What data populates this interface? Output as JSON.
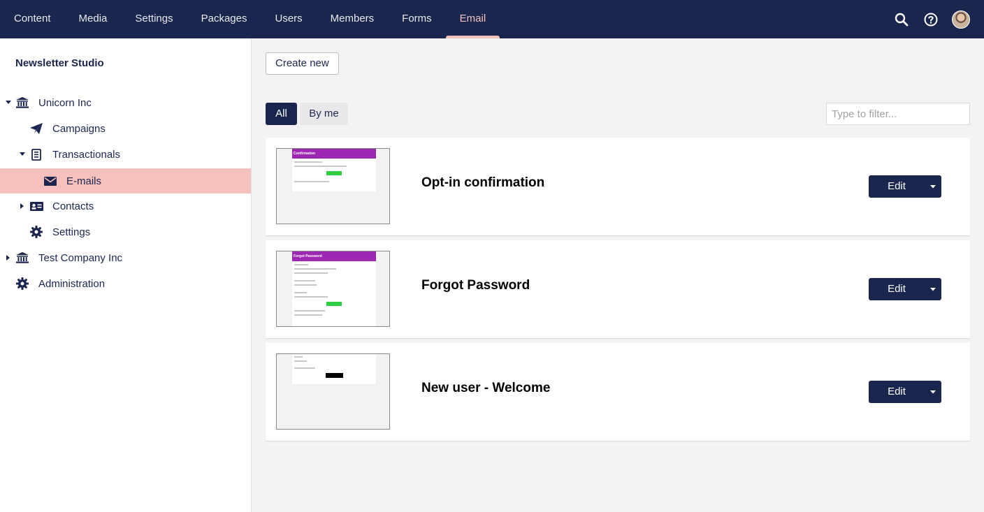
{
  "top_nav": {
    "items": [
      {
        "label": "Content"
      },
      {
        "label": "Media"
      },
      {
        "label": "Settings"
      },
      {
        "label": "Packages"
      },
      {
        "label": "Users"
      },
      {
        "label": "Members"
      },
      {
        "label": "Forms"
      },
      {
        "label": "Email"
      }
    ],
    "active": "Email",
    "tools": [
      "search-icon",
      "help-icon",
      "avatar"
    ]
  },
  "sidebar": {
    "title": "Newsletter Studio",
    "tree": [
      {
        "label": "Unicorn Inc",
        "icon": "bank-icon",
        "expanded": true
      },
      {
        "label": "Campaigns",
        "icon": "paper-plane-icon"
      },
      {
        "label": "Transactionals",
        "icon": "receipt-icon",
        "expanded": true
      },
      {
        "label": "E-mails",
        "icon": "envelope-icon",
        "selected": true
      },
      {
        "label": "Contacts",
        "icon": "contact-card-icon",
        "expanded": false
      },
      {
        "label": "Settings",
        "icon": "gear-icon"
      },
      {
        "label": "Test Company Inc",
        "icon": "bank-icon",
        "expanded": false
      },
      {
        "label": "Administration",
        "icon": "gear-icon"
      }
    ]
  },
  "main": {
    "create_label": "Create new",
    "tabs": [
      {
        "label": "All",
        "active": true
      },
      {
        "label": "By me",
        "active": false
      }
    ],
    "filter_placeholder": "Type to filter...",
    "emails": [
      {
        "title": "Opt-in confirmation",
        "edit_label": "Edit",
        "thumb_header": "Confirmation",
        "thumb_header_color": "#9c27b0",
        "thumb_button_color": "#2ecc40"
      },
      {
        "title": "Forgot Password",
        "edit_label": "Edit",
        "thumb_header": "Forgot Password",
        "thumb_header_color": "#9c27b0",
        "thumb_button_color": "#2ecc40"
      },
      {
        "title": "New user - Welcome",
        "edit_label": "Edit",
        "thumb_header": "",
        "thumb_header_color": "",
        "thumb_button_color": "#000000"
      }
    ]
  },
  "colors": {
    "header_bg": "#1b264f",
    "accent": "#f5c1bc",
    "page_bg": "#f4f2f3"
  }
}
